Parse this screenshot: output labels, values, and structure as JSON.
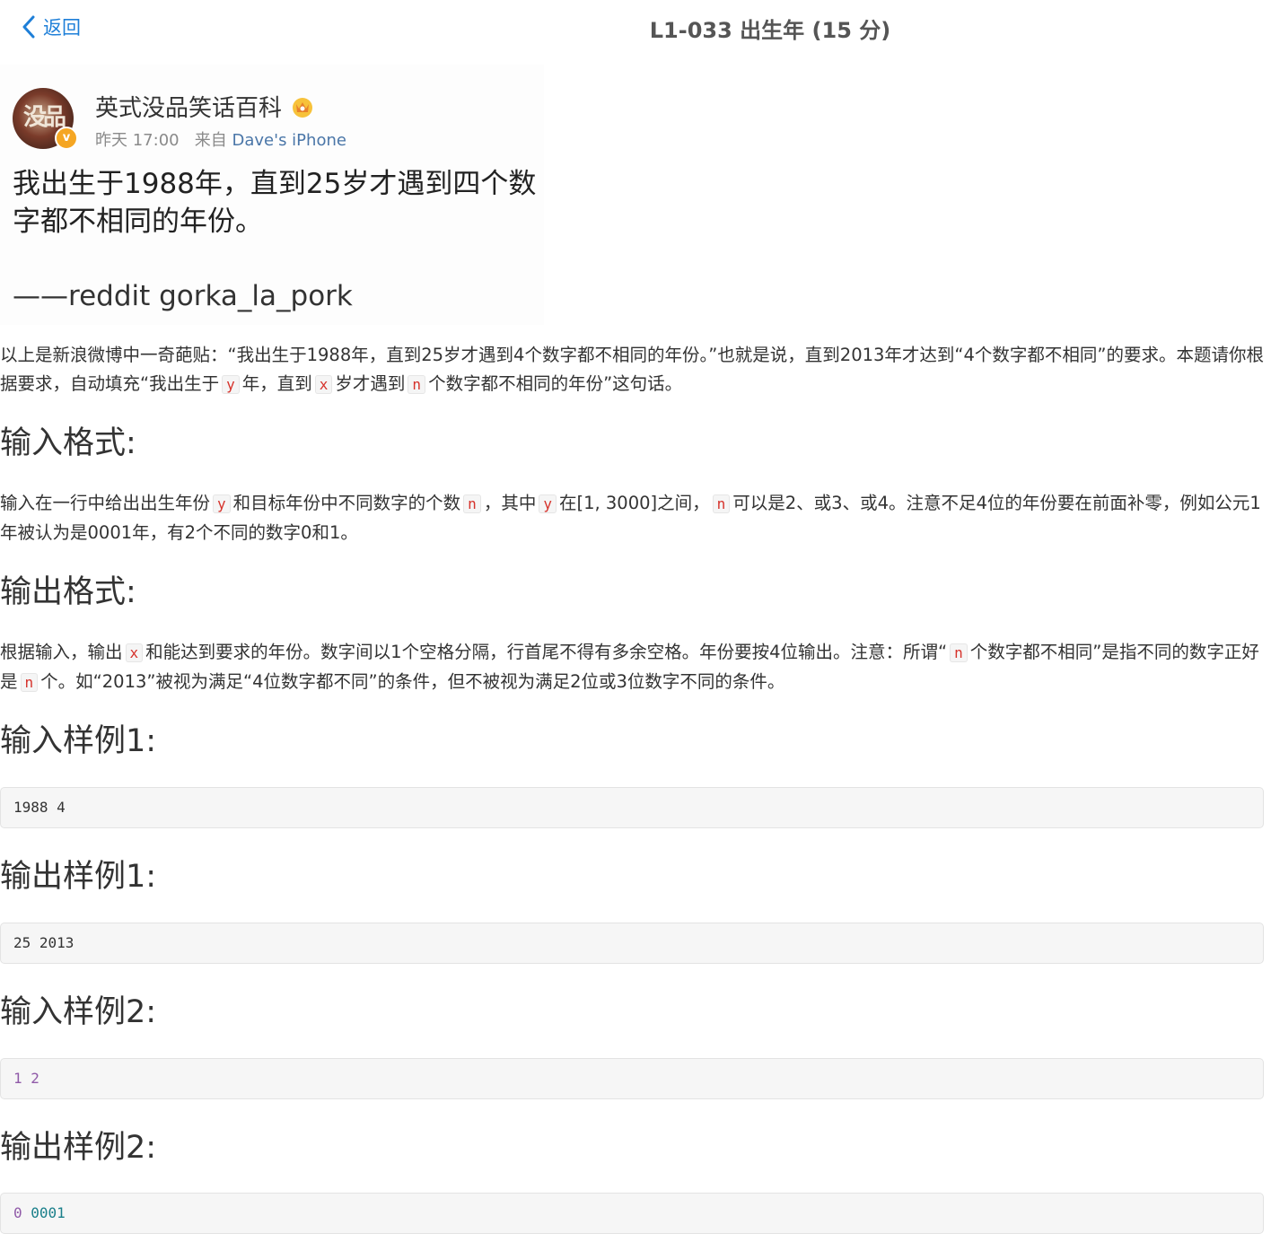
{
  "header": {
    "back_label": "返回",
    "title": "L1-033 出生年 (15 分)"
  },
  "weibo": {
    "user_name": "英式没品笑话百科",
    "time": "昨天 17:00",
    "source_prefix": "来自",
    "source": "Dave's iPhone",
    "text": "我出生于1988年，直到25岁才遇到四个数字都不相同的年份。",
    "quote": "——reddit gorka_la_pork"
  },
  "intro": {
    "p1": "以上是新浪微博中一奇葩贴：“我出生于1988年，直到25岁才遇到4个数字都不相同的年份。”也就是说，直到2013年才达到“4个数字都不相同”的要求。本题请你根据要求，自动填充“我出生于",
    "v1": "y",
    "p2": "年，直到",
    "v2": "x",
    "p3": "岁才遇到",
    "v3": "n",
    "p4": "个数字都不相同的年份”这句话。"
  },
  "input_format": {
    "heading": "输入格式:",
    "p1": "输入在一行中给出出生年份",
    "v1": "y",
    "p2": "和目标年份中不同数字的个数",
    "v2": "n",
    "p3": "，其中",
    "v3": "y",
    "p4": "在[1, 3000]之间，",
    "v4": "n",
    "p5": "可以是2、或3、或4。注意不足4位的年份要在前面补零，例如公元1年被认为是0001年，有2个不同的数字0和1。"
  },
  "output_format": {
    "heading": "输出格式:",
    "p1": "根据输入，输出",
    "v1": "x",
    "p2": "和能达到要求的年份。数字间以1个空格分隔，行首尾不得有多余空格。年份要按4位输出。注意：所谓“",
    "v2": "n",
    "p3": "个数字都不相同”是指不同的数字正好是",
    "v3": "n",
    "p4": "个。如“2013”被视为满足“4位数字都不同”的条件，但不被视为满足2位或3位数字不同的条件。"
  },
  "samples": [
    {
      "heading": "输入样例1:",
      "a": "1988 4",
      "b": ""
    },
    {
      "heading": "输出样例1:",
      "a": "25 2013",
      "b": ""
    },
    {
      "heading": "输入样例2:",
      "a": "1",
      "b": "2"
    },
    {
      "heading": "输出样例2:",
      "a": "0",
      "b": "0001"
    }
  ],
  "colors": {
    "link_blue": "#1e7fd8",
    "inline_code_red": "#d6322b",
    "code_purple": "#905aa8",
    "code_teal": "#1a7f8a"
  }
}
